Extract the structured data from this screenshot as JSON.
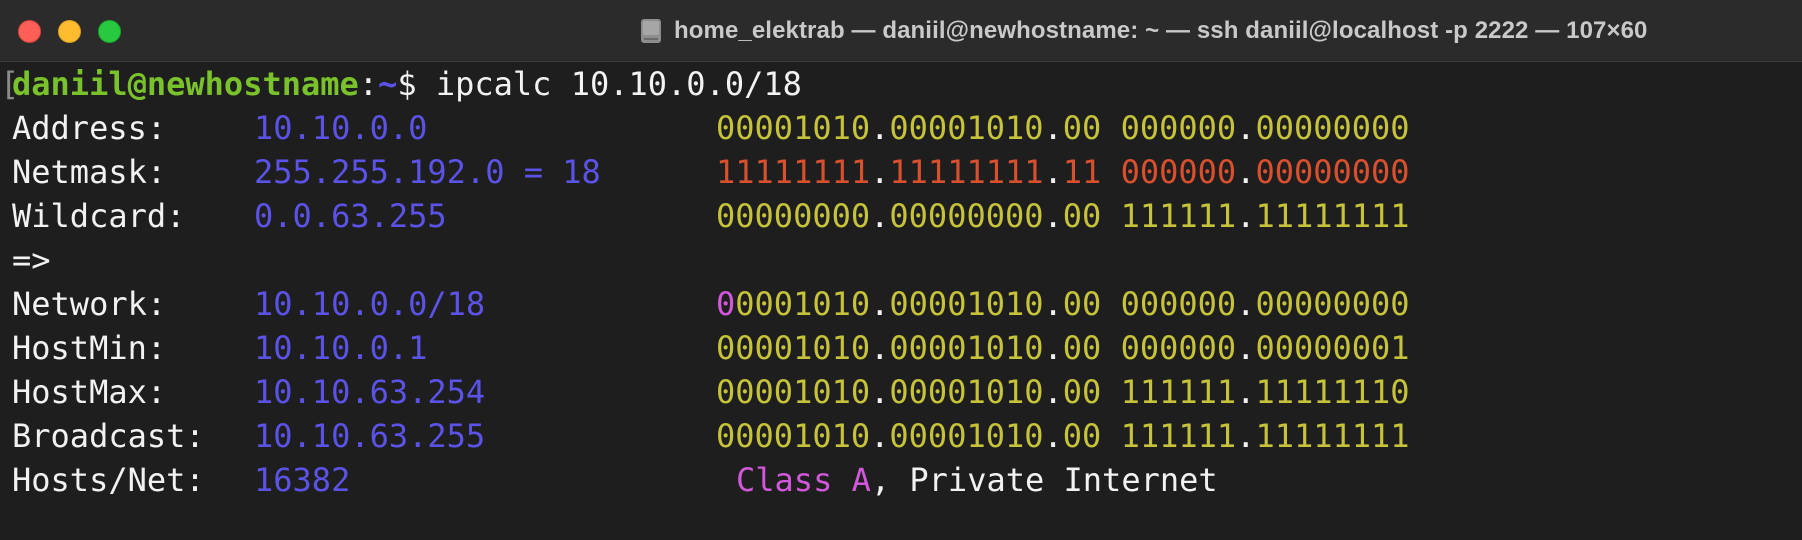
{
  "window": {
    "title": "home_elektrab — daniil@newhostname: ~ — ssh daniil@localhost -p 2222 — 107×60",
    "title_icon": "hard-drive-icon",
    "buttons": {
      "close": "close",
      "minimize": "minimize",
      "zoom": "zoom"
    }
  },
  "prompt": {
    "bracket": "[",
    "user_host": "daniil@newhostname",
    "colon": ":",
    "path": "~",
    "symbol": "$",
    "command": " ipcalc 10.10.0.0/18"
  },
  "rows": [
    {
      "label": "Address:",
      "value": "10.10.0.0",
      "bits": {
        "a": "00001010",
        "d1": ".",
        "b": "00001010",
        "d2": ".",
        "c": "00",
        "sp": " ",
        "d": "000000",
        "d3": ".",
        "e": "00000000"
      }
    },
    {
      "label": "Netmask:",
      "value": "255.255.192.0 = 18",
      "bits": {
        "a": "11111111",
        "d1": ".",
        "b": "11111111",
        "d2": ".",
        "c": "11",
        "sp": " ",
        "d": "000000",
        "d3": ".",
        "e": "00000000"
      }
    },
    {
      "label": "Wildcard:",
      "value": "0.0.63.255",
      "bits": {
        "a": "00000000",
        "d1": ".",
        "b": "00000000",
        "d2": ".",
        "c": "00",
        "sp": " ",
        "d": "111111",
        "d3": ".",
        "e": "11111111"
      }
    },
    {
      "label": "=>"
    },
    {
      "label": "Network:",
      "value": "10.10.0.0/18",
      "bits": {
        "first": "0",
        "a": "0001010",
        "d1": ".",
        "b": "00001010",
        "d2": ".",
        "c": "00",
        "sp": " ",
        "d": "000000",
        "d3": ".",
        "e": "00000000"
      }
    },
    {
      "label": "HostMin:",
      "value": "10.10.0.1",
      "bits": {
        "a": "00001010",
        "d1": ".",
        "b": "00001010",
        "d2": ".",
        "c": "00",
        "sp": " ",
        "d": "000000",
        "d3": ".",
        "e": "00000001"
      }
    },
    {
      "label": "HostMax:",
      "value": "10.10.63.254",
      "bits": {
        "a": "00001010",
        "d1": ".",
        "b": "00001010",
        "d2": ".",
        "c": "00",
        "sp": " ",
        "d": "111111",
        "d3": ".",
        "e": "11111110"
      }
    },
    {
      "label": "Broadcast:",
      "value": "10.10.63.255",
      "bits": {
        "a": "00001010",
        "d1": ".",
        "b": "00001010",
        "d2": ".",
        "c": "00",
        "sp": " ",
        "d": "111111",
        "d3": ".",
        "e": "11111111"
      }
    },
    {
      "label": "Hosts/Net:",
      "value": "16382",
      "class_text": "Class A",
      "class_rest": ", Private Internet"
    }
  ],
  "colors": {
    "background": "#1e1e1e",
    "prompt_green": "#79c22b",
    "value_blue": "#5b53e8",
    "bits_yellow": "#c6c23a",
    "netmask_red": "#d9502f",
    "class_magenta": "#d357db"
  }
}
